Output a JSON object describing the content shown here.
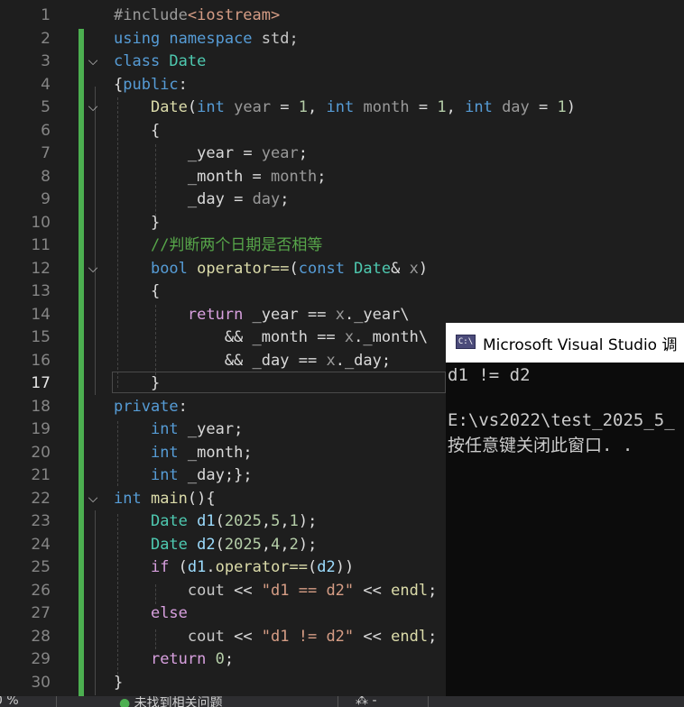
{
  "editor": {
    "current_line": 17,
    "lines": [
      {
        "n": 1,
        "fold": "",
        "segs": [
          {
            "t": "#include",
            "c": "pre"
          },
          {
            "t": "<iostream>",
            "c": "str"
          }
        ]
      },
      {
        "n": 2,
        "fold": "",
        "segs": [
          {
            "t": "using ",
            "c": "kw"
          },
          {
            "t": "namespace ",
            "c": "kw"
          },
          {
            "t": "std;",
            "c": "ns"
          }
        ]
      },
      {
        "n": 3,
        "fold": "v",
        "segs": [
          {
            "t": "class ",
            "c": "kw"
          },
          {
            "t": "Date",
            "c": "cls"
          }
        ]
      },
      {
        "n": 4,
        "fold": "",
        "segs": [
          {
            "t": "{"
          },
          {
            "t": "public",
            "c": "kw"
          },
          {
            "t": ":"
          }
        ]
      },
      {
        "n": 5,
        "fold": "v",
        "segs": [
          {
            "t": "    "
          },
          {
            "t": "Date",
            "c": "fn"
          },
          {
            "t": "("
          },
          {
            "t": "int ",
            "c": "kw"
          },
          {
            "t": "year",
            "c": "par"
          },
          {
            "t": " = "
          },
          {
            "t": "1",
            "c": "num"
          },
          {
            "t": ", "
          },
          {
            "t": "int ",
            "c": "kw"
          },
          {
            "t": "month",
            "c": "par"
          },
          {
            "t": " = "
          },
          {
            "t": "1",
            "c": "num"
          },
          {
            "t": ", "
          },
          {
            "t": "int ",
            "c": "kw"
          },
          {
            "t": "day",
            "c": "par"
          },
          {
            "t": " = "
          },
          {
            "t": "1",
            "c": "num"
          },
          {
            "t": ")"
          }
        ]
      },
      {
        "n": 6,
        "fold": "",
        "segs": [
          {
            "t": "    {"
          }
        ]
      },
      {
        "n": 7,
        "fold": "",
        "segs": [
          {
            "t": "        "
          },
          {
            "t": "_year",
            "c": "mem"
          },
          {
            "t": " = "
          },
          {
            "t": "year",
            "c": "par"
          },
          {
            "t": ";"
          }
        ]
      },
      {
        "n": 8,
        "fold": "",
        "segs": [
          {
            "t": "        "
          },
          {
            "t": "_month",
            "c": "mem"
          },
          {
            "t": " = "
          },
          {
            "t": "month",
            "c": "par"
          },
          {
            "t": ";"
          }
        ]
      },
      {
        "n": 9,
        "fold": "",
        "segs": [
          {
            "t": "        "
          },
          {
            "t": "_day",
            "c": "mem"
          },
          {
            "t": " = "
          },
          {
            "t": "day",
            "c": "par"
          },
          {
            "t": ";"
          }
        ]
      },
      {
        "n": 10,
        "fold": "",
        "segs": [
          {
            "t": "    }"
          }
        ]
      },
      {
        "n": 11,
        "fold": "",
        "segs": [
          {
            "t": "    "
          },
          {
            "t": "//判断两个日期是否相等",
            "c": "cmt"
          }
        ]
      },
      {
        "n": 12,
        "fold": "v",
        "segs": [
          {
            "t": "    "
          },
          {
            "t": "bool ",
            "c": "kw"
          },
          {
            "t": "operator==",
            "c": "fn"
          },
          {
            "t": "("
          },
          {
            "t": "const ",
            "c": "kw"
          },
          {
            "t": "Date",
            "c": "cls"
          },
          {
            "t": "& "
          },
          {
            "t": "x",
            "c": "par"
          },
          {
            "t": ")"
          }
        ]
      },
      {
        "n": 13,
        "fold": "",
        "segs": [
          {
            "t": "    {"
          }
        ]
      },
      {
        "n": 14,
        "fold": "",
        "segs": [
          {
            "t": "        "
          },
          {
            "t": "return ",
            "c": "ctl"
          },
          {
            "t": "_year",
            "c": "mem"
          },
          {
            "t": " == "
          },
          {
            "t": "x",
            "c": "par"
          },
          {
            "t": "."
          },
          {
            "t": "_year",
            "c": "mem"
          },
          {
            "t": "\\"
          }
        ]
      },
      {
        "n": 15,
        "fold": "",
        "segs": [
          {
            "t": "            && "
          },
          {
            "t": "_month",
            "c": "mem"
          },
          {
            "t": " == "
          },
          {
            "t": "x",
            "c": "par"
          },
          {
            "t": "."
          },
          {
            "t": "_month",
            "c": "mem"
          },
          {
            "t": "\\"
          }
        ]
      },
      {
        "n": 16,
        "fold": "",
        "segs": [
          {
            "t": "            && "
          },
          {
            "t": "_day",
            "c": "mem"
          },
          {
            "t": " == "
          },
          {
            "t": "x",
            "c": "par"
          },
          {
            "t": "."
          },
          {
            "t": "_day",
            "c": "mem"
          },
          {
            "t": ";"
          }
        ]
      },
      {
        "n": 17,
        "fold": "",
        "segs": [
          {
            "t": "    }"
          }
        ]
      },
      {
        "n": 18,
        "fold": "",
        "segs": [
          {
            "t": "private",
            "c": "kw"
          },
          {
            "t": ":"
          }
        ]
      },
      {
        "n": 19,
        "fold": "",
        "segs": [
          {
            "t": "    "
          },
          {
            "t": "int ",
            "c": "kw"
          },
          {
            "t": "_year",
            "c": "mem"
          },
          {
            "t": ";"
          }
        ]
      },
      {
        "n": 20,
        "fold": "",
        "segs": [
          {
            "t": "    "
          },
          {
            "t": "int ",
            "c": "kw"
          },
          {
            "t": "_month",
            "c": "mem"
          },
          {
            "t": ";"
          }
        ]
      },
      {
        "n": 21,
        "fold": "",
        "segs": [
          {
            "t": "    "
          },
          {
            "t": "int ",
            "c": "kw"
          },
          {
            "t": "_day",
            "c": "mem"
          },
          {
            "t": ";};"
          }
        ]
      },
      {
        "n": 22,
        "fold": "v",
        "segs": [
          {
            "t": "int ",
            "c": "kw"
          },
          {
            "t": "main",
            "c": "fn"
          },
          {
            "t": "(){"
          }
        ]
      },
      {
        "n": 23,
        "fold": "",
        "segs": [
          {
            "t": "    "
          },
          {
            "t": "Date ",
            "c": "cls"
          },
          {
            "t": "d1",
            "c": "var"
          },
          {
            "t": "("
          },
          {
            "t": "2025",
            "c": "num"
          },
          {
            "t": ","
          },
          {
            "t": "5",
            "c": "num"
          },
          {
            "t": ","
          },
          {
            "t": "1",
            "c": "num"
          },
          {
            "t": ");"
          }
        ]
      },
      {
        "n": 24,
        "fold": "",
        "segs": [
          {
            "t": "    "
          },
          {
            "t": "Date ",
            "c": "cls"
          },
          {
            "t": "d2",
            "c": "var"
          },
          {
            "t": "("
          },
          {
            "t": "2025",
            "c": "num"
          },
          {
            "t": ","
          },
          {
            "t": "4",
            "c": "num"
          },
          {
            "t": ","
          },
          {
            "t": "2",
            "c": "num"
          },
          {
            "t": ");"
          }
        ]
      },
      {
        "n": 25,
        "fold": "",
        "segs": [
          {
            "t": "    "
          },
          {
            "t": "if ",
            "c": "ctl"
          },
          {
            "t": "("
          },
          {
            "t": "d1",
            "c": "var"
          },
          {
            "t": "."
          },
          {
            "t": "operator==",
            "c": "fn"
          },
          {
            "t": "("
          },
          {
            "t": "d2",
            "c": "var"
          },
          {
            "t": "))"
          }
        ]
      },
      {
        "n": 26,
        "fold": "",
        "segs": [
          {
            "t": "        "
          },
          {
            "t": "cout",
            "c": "ns"
          },
          {
            "t": " << "
          },
          {
            "t": "\"d1 == d2\"",
            "c": "str"
          },
          {
            "t": " << "
          },
          {
            "t": "endl",
            "c": "fn"
          },
          {
            "t": ";"
          }
        ]
      },
      {
        "n": 27,
        "fold": "",
        "segs": [
          {
            "t": "    "
          },
          {
            "t": "else",
            "c": "ctl"
          }
        ]
      },
      {
        "n": 28,
        "fold": "",
        "segs": [
          {
            "t": "        "
          },
          {
            "t": "cout",
            "c": "ns"
          },
          {
            "t": " << "
          },
          {
            "t": "\"d1 != d2\"",
            "c": "str"
          },
          {
            "t": " << "
          },
          {
            "t": "endl",
            "c": "fn"
          },
          {
            "t": ";"
          }
        ]
      },
      {
        "n": 29,
        "fold": "",
        "segs": [
          {
            "t": "    "
          },
          {
            "t": "return ",
            "c": "ctl"
          },
          {
            "t": "0",
            "c": "num"
          },
          {
            "t": ";"
          }
        ]
      },
      {
        "n": 30,
        "fold": "",
        "segs": [
          {
            "t": "}"
          }
        ]
      }
    ]
  },
  "console": {
    "icon_text": "C:\\",
    "title": "Microsoft Visual Studio 调",
    "output": [
      "d1 != d2",
      "",
      "E:\\vs2022\\test_2025_5_",
      "按任意键关闭此窗口. ."
    ]
  },
  "statusbar": {
    "zoom": "0 %",
    "issues": "未找到相关问题",
    "tool": "⁂ -"
  }
}
